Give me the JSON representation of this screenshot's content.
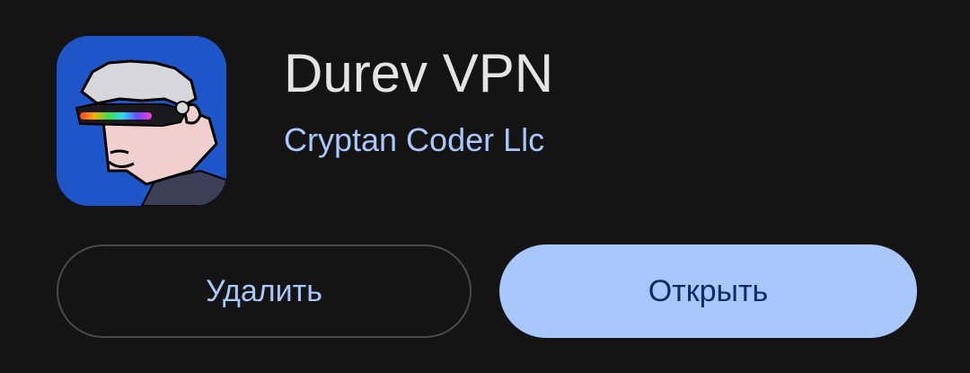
{
  "app": {
    "name": "Durev VPN",
    "developer": "Cryptan Coder Llc",
    "icon": "durev-vpn-app-icon"
  },
  "actions": {
    "uninstall_label": "Удалить",
    "open_label": "Открыть"
  },
  "colors": {
    "background": "#141414",
    "accent": "#a8c7fa",
    "open_button_text": "#0b2d63",
    "outline": "#4a4a4a"
  }
}
